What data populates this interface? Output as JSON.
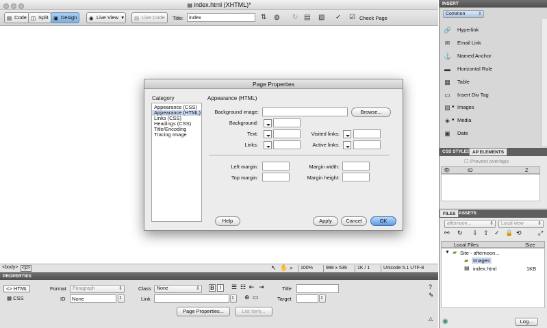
{
  "window": {
    "title": "index.html (XHTML)*"
  },
  "toolbar": {
    "code_label": "Code",
    "split_label": "Split",
    "design_label": "Design",
    "live_view_label": "Live View",
    "live_code_label": "Live Code",
    "title_label": "Title:",
    "title_value": "index",
    "check_page_label": "Check Page"
  },
  "status_bar": {
    "tags": [
      "<body>",
      "<p>"
    ],
    "zoom": "100%",
    "dimensions": "988 x 539",
    "download": "1K / 1 sec",
    "encoding": "Unicode 5.1 UTF-8"
  },
  "properties": {
    "header": "PROPERTIES",
    "html_label": "HTML",
    "css_label": "CSS",
    "format_label": "Format",
    "format_value": "Paragraph",
    "class_label": "Class",
    "class_value": "None",
    "id_label": "ID",
    "id_value": "None",
    "link_label": "Link",
    "title_label": "Title",
    "target_label": "Target",
    "bold": "B",
    "italic": "I",
    "page_properties_button": "Page Properties...",
    "list_item_button": "List Item..."
  },
  "insert_panel": {
    "header": "INSERT",
    "category": "Common",
    "items": [
      {
        "label": "Hyperlink",
        "icon": "hyperlink-icon"
      },
      {
        "label": "Email Link",
        "icon": "email-link-icon"
      },
      {
        "label": "Named Anchor",
        "icon": "anchor-icon"
      },
      {
        "label": "Horizontal Rule",
        "icon": "horizontal-rule-icon"
      },
      {
        "label": "Table",
        "icon": "table-icon"
      },
      {
        "label": "Insert Div Tag",
        "icon": "div-tag-icon"
      },
      {
        "label": "Images",
        "icon": "image-icon"
      },
      {
        "label": "Media",
        "icon": "media-icon"
      },
      {
        "label": "Date",
        "icon": "date-icon"
      }
    ]
  },
  "css_panel": {
    "tab_css": "CSS STYLES",
    "tab_ap": "AP ELEMENTS",
    "prevent_overlaps": "Prevent overlaps",
    "col_id": "ID",
    "col_z": "Z"
  },
  "files_panel": {
    "tab_files": "FILES",
    "tab_assets": "ASSETS",
    "site_select": "afternoon...",
    "view_select": "Local view",
    "col_local": "Local Files",
    "col_size": "Size",
    "tree": [
      {
        "label": "Site - afternoon...",
        "size": ""
      },
      {
        "label": "Images",
        "size": ""
      },
      {
        "label": "index.html",
        "size": "1KB"
      }
    ],
    "log_button": "Log..."
  },
  "dialog": {
    "title": "Page Properties",
    "category_label": "Category",
    "categories": [
      "Appearance (CSS)",
      "Appearance (HTML)",
      "Links (CSS)",
      "Headings (CSS)",
      "Title/Encoding",
      "Tracing Image"
    ],
    "selected_category": "Appearance (HTML)",
    "section_title": "Appearance (HTML)",
    "background_image_label": "Background image:",
    "browse_button": "Browse...",
    "background_label": "Background:",
    "text_label": "Text:",
    "visited_links_label": "Visited links:",
    "links_label": "Links:",
    "active_links_label": "Active links:",
    "left_margin_label": "Left margin:",
    "margin_width_label": "Margin width:",
    "top_margin_label": "Top margin:",
    "margin_height_label": "Margin height:",
    "help_button": "Help",
    "apply_button": "Apply",
    "cancel_button": "Cancel",
    "ok_button": "OK"
  }
}
